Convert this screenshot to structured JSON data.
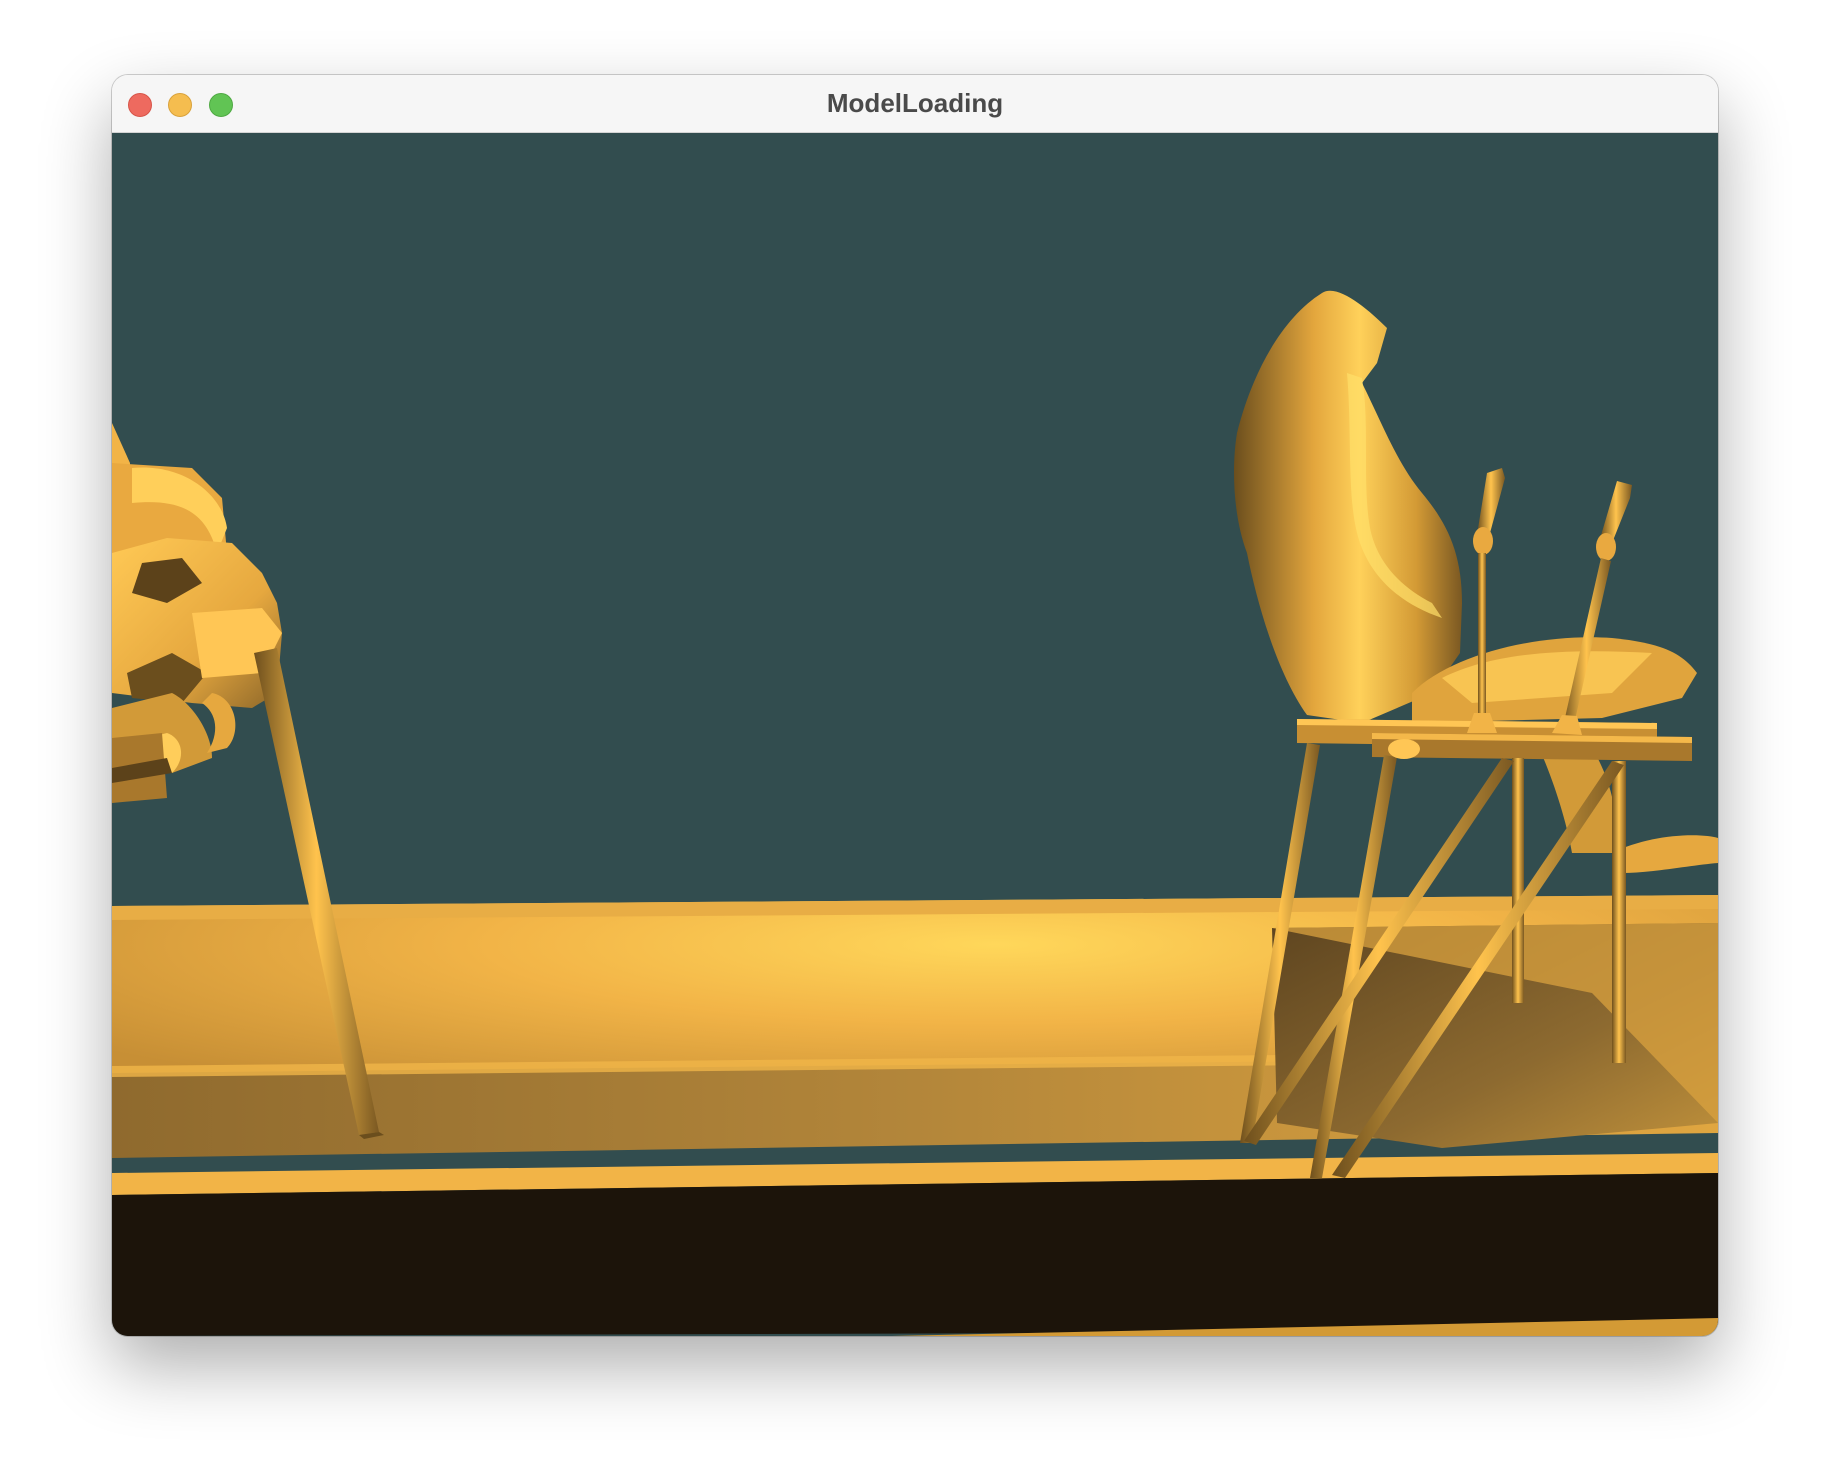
{
  "window": {
    "title": "ModelLoading",
    "controls": {
      "close": "close-icon",
      "minimize": "minimize-icon",
      "maximize": "maximize-icon"
    }
  },
  "scene": {
    "background_color": "#324d4f",
    "model_color": "#f2b24a",
    "shadow_color": "#1c140a"
  }
}
